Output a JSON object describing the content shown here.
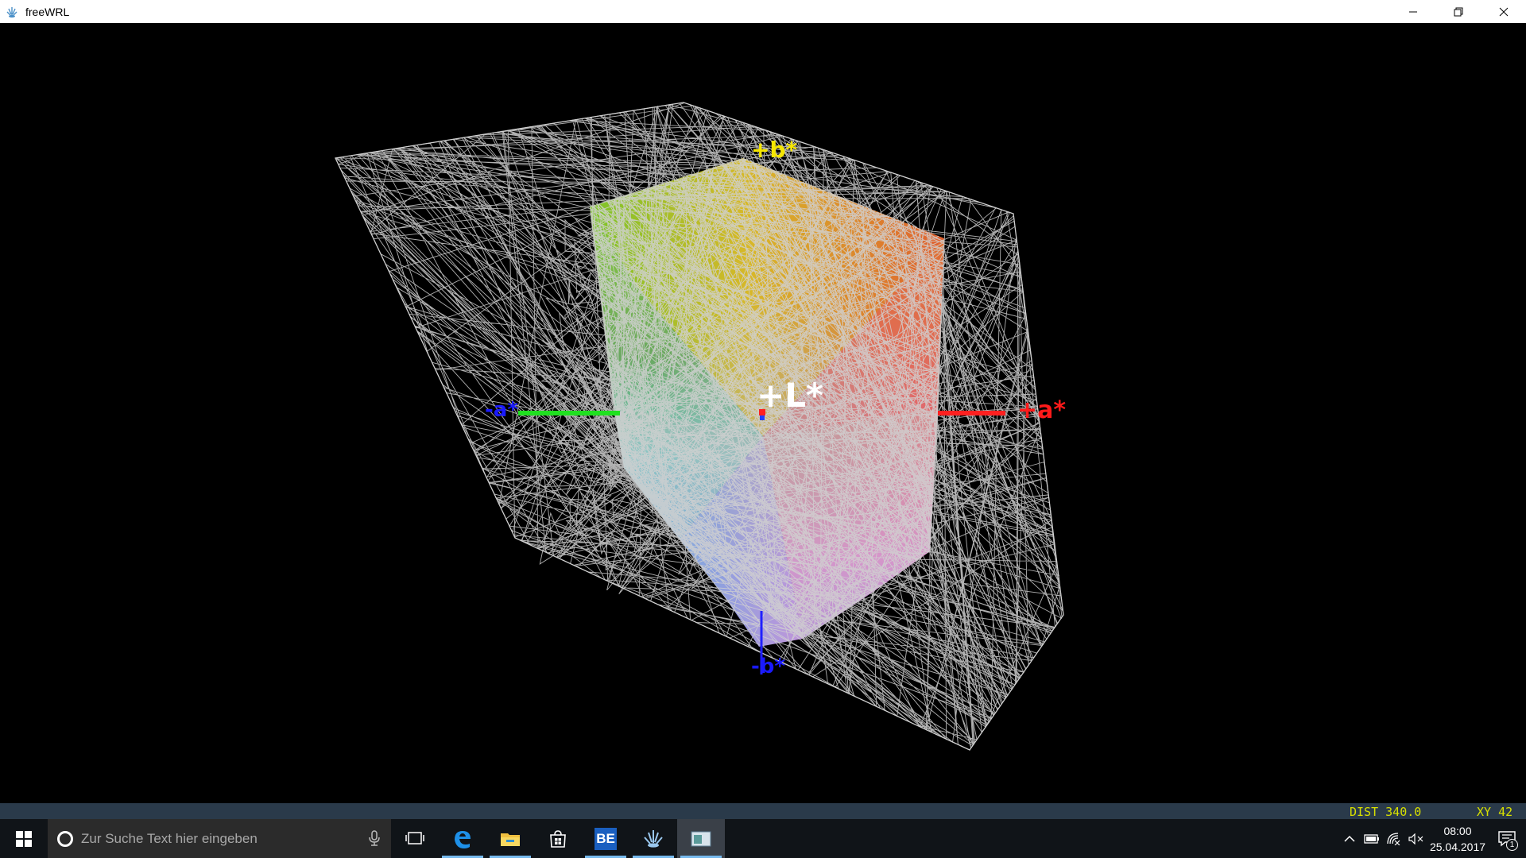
{
  "window": {
    "title": "freeWRL",
    "buttons": [
      "minimize",
      "restore",
      "close"
    ]
  },
  "scene": {
    "axis_labels": {
      "plus_b": "+b*",
      "minus_b": "-b*",
      "plus_a": "+a*",
      "minus_a": "-a*",
      "plus_l": "+L*"
    },
    "colors": {
      "plus_b": "#f5e600",
      "minus_b": "#1a1aff",
      "plus_a": "#ff1a1a",
      "minus_a": "#1a1aff",
      "plus_l": "#ffffff",
      "wireframe": "#d0d0d0",
      "axis_green": "#20e020",
      "axis_red": "#ff2020",
      "axis_blue": "#2020ff"
    }
  },
  "status": {
    "dist": "DIST 340.0",
    "xy": "XY  42"
  },
  "taskbar": {
    "search_placeholder": "Zur Suche Text hier eingeben",
    "apps": [
      "task-view",
      "edge",
      "file-explorer",
      "store",
      "be-app",
      "freewrl",
      "window-app"
    ],
    "be_label": "BE",
    "clock_time": "08:00",
    "clock_date": "25.04.2017",
    "notification_count": "1"
  }
}
